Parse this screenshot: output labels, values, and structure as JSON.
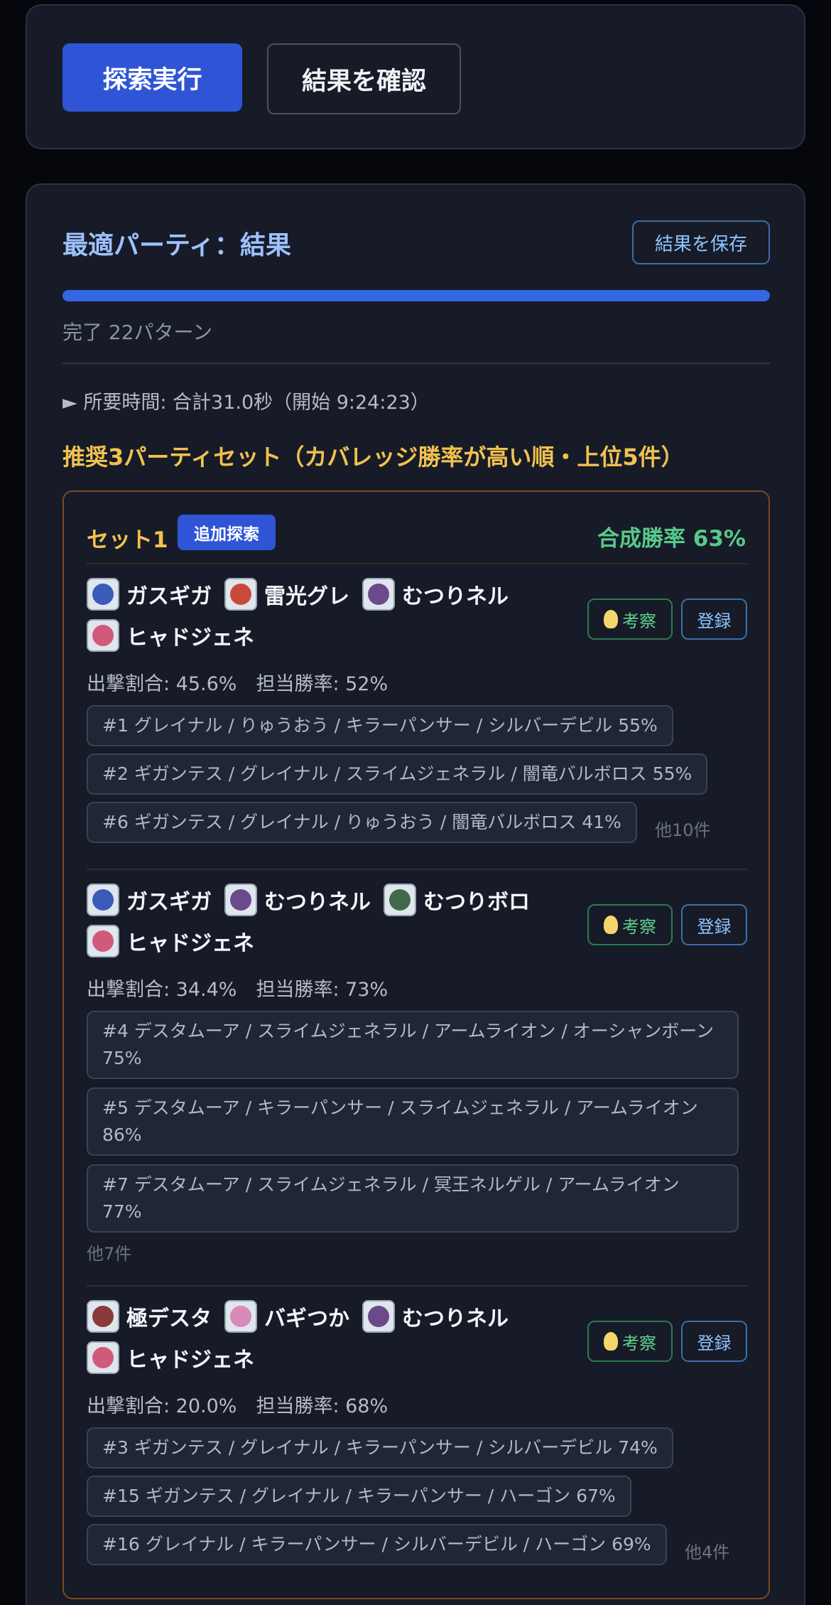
{
  "actions": {
    "search_label": "探索実行",
    "check_label": "結果を確認"
  },
  "result": {
    "title": "最適パーティ：結果",
    "save_label": "結果を保存",
    "progress_fraction": 1.0,
    "progress_text": "完了 22パターン",
    "elapsed": "► 所要時間: 合計31.0秒（開始 9:24:23）",
    "recommend_title": "推奨3パーティセット（カバレッジ勝率が高い順・上位5件）"
  },
  "colors": {
    "accent": "#2f55d6",
    "gold": "#f2c14e",
    "green": "#58c98a",
    "blue_text": "#9ec1ff"
  },
  "set": {
    "label": "セット1",
    "extra_search_label": "追加探索",
    "win_rate": "合成勝率 63%",
    "parties": [
      {
        "monsters": [
          {
            "name": "ガスギガ",
            "icon": "blue-robot-icon"
          },
          {
            "name": "雷光グレ",
            "icon": "dragon-icon"
          },
          {
            "name": "むつりネル",
            "icon": "demon-icon"
          },
          {
            "name": "ヒャドジェネ",
            "icon": "slime-general-icon"
          }
        ],
        "consider_label": "考察",
        "register_label": "登録",
        "stats": "出撃割合: 45.6%　担当勝率: 52%",
        "combos": [
          "#1 グレイナル / りゅうおう / キラーパンサー / シルバーデビル  55%",
          "#2 ギガンテス / グレイナル / スライムジェネラル / 闇竜バルボロス  55%",
          "#6 ギガンテス / グレイナル / りゅうおう / 闇竜バルボロス  41%"
        ],
        "more": "他10件"
      },
      {
        "monsters": [
          {
            "name": "ガスギガ",
            "icon": "blue-robot-icon"
          },
          {
            "name": "むつりネル",
            "icon": "demon-icon"
          },
          {
            "name": "むつりボロ",
            "icon": "dark-dragon-icon"
          },
          {
            "name": "ヒャドジェネ",
            "icon": "slime-general-icon"
          }
        ],
        "consider_label": "考察",
        "register_label": "登録",
        "stats": "出撃割合: 34.4%　担当勝率: 73%",
        "combos": [
          "#4 デスタムーア / スライムジェネラル / アームライオン / オーシャンボーン 75%",
          "#5 デスタムーア / キラーパンサー / スライムジェネラル / アームライオン 86%",
          "#7 デスタムーア / スライムジェネラル / 冥王ネルゲル / アームライオン 77%"
        ],
        "more": "他7件"
      },
      {
        "monsters": [
          {
            "name": "極デスタ",
            "icon": "beast-icon"
          },
          {
            "name": "バギつか",
            "icon": "pink-monster-icon"
          },
          {
            "name": "むつりネル",
            "icon": "demon-icon"
          },
          {
            "name": "ヒャドジェネ",
            "icon": "slime-general-icon"
          }
        ],
        "consider_label": "考察",
        "register_label": "登録",
        "stats": "出撃割合: 20.0%　担当勝率: 68%",
        "combos": [
          "#3 ギガンテス / グレイナル / キラーパンサー / シルバーデビル  74%",
          "#15 ギガンテス / グレイナル / キラーパンサー / ハーゴン  67%",
          "#16 グレイナル / キラーパンサー / シルバーデビル / ハーゴン  69%"
        ],
        "more": "他4件"
      }
    ]
  }
}
